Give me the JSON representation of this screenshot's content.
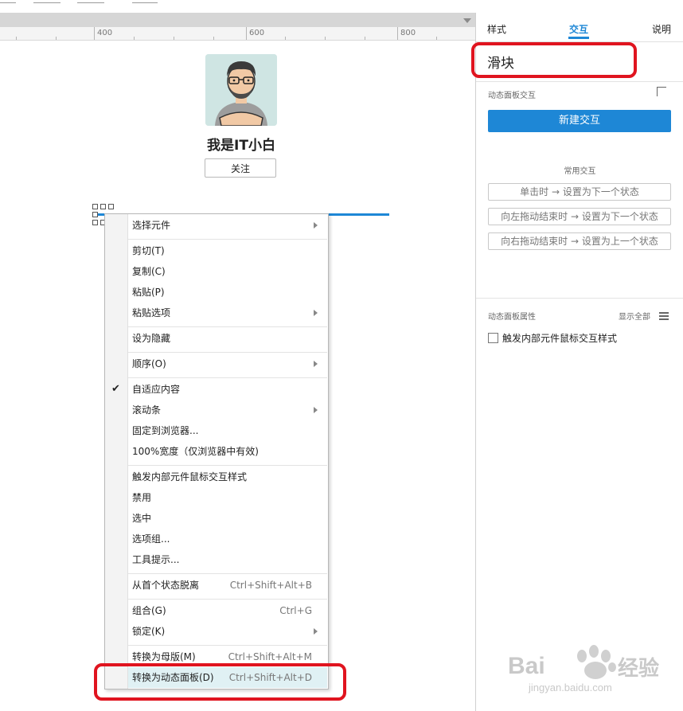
{
  "ruler": {
    "ticks": [
      "400",
      "600",
      "800"
    ]
  },
  "canvas": {
    "profile_name": "我是IT小白",
    "follow_label": "关注"
  },
  "context_menu": {
    "items": [
      {
        "label": "选择元件",
        "submenu": true
      },
      {
        "label": "剪切(T)"
      },
      {
        "label": "复制(C)"
      },
      {
        "label": "粘贴(P)"
      },
      {
        "label": "粘贴选项",
        "submenu": true
      },
      {
        "label": "设为隐藏"
      },
      {
        "label": "顺序(O)",
        "submenu": true
      },
      {
        "label": "自适应内容",
        "checked": true
      },
      {
        "label": "滚动条",
        "submenu": true
      },
      {
        "label": "固定到浏览器..."
      },
      {
        "label": "100%宽度（仅浏览器中有效)"
      },
      {
        "label": "触发内部元件鼠标交互样式"
      },
      {
        "label": "禁用"
      },
      {
        "label": "选中"
      },
      {
        "label": "选项组..."
      },
      {
        "label": "工具提示..."
      },
      {
        "label": "从首个状态脱离",
        "shortcut": "Ctrl+Shift+Alt+B"
      },
      {
        "label": "组合(G)",
        "shortcut": "Ctrl+G"
      },
      {
        "label": "锁定(K)",
        "submenu": true
      },
      {
        "label": "转换为母版(M)",
        "shortcut": "Ctrl+Shift+Alt+M"
      },
      {
        "label": "转换为动态面板(D)",
        "shortcut": "Ctrl+Shift+Alt+D",
        "highlighted": true
      }
    ]
  },
  "panel": {
    "tabs": [
      "样式",
      "交互",
      "说明"
    ],
    "active_tab": "交互",
    "widget_name": "滑块",
    "section_interactions": "动态面板交互",
    "new_interaction": "新建交互",
    "common_interactions_title": "常用交互",
    "common_interactions": [
      "单击时 → 设置为下一个状态",
      "向左拖动结束时 → 设置为下一个状态",
      "向右拖动结束时 → 设置为上一个状态"
    ],
    "section_properties": "动态面板属性",
    "show_all": "显示全部",
    "checkbox_label": "触发内部元件鼠标交互样式"
  },
  "watermark": {
    "brand": "Baidu",
    "sub": "经验",
    "url": "jingyan.baidu.com"
  },
  "colors": {
    "accent": "#1e87d6",
    "annotation": "#e0141f",
    "highlight": "#e0f1f4"
  }
}
